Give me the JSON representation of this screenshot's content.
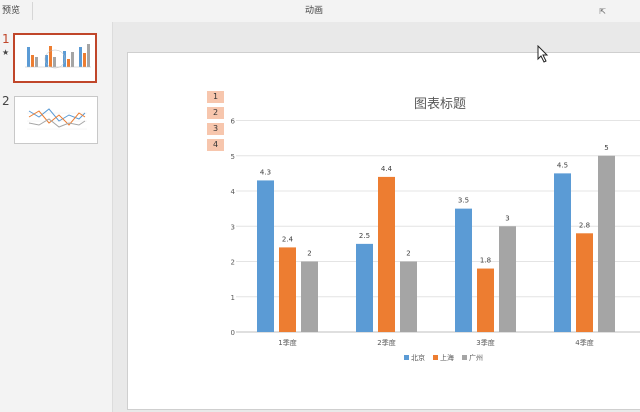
{
  "ribbon": {
    "preview_label": "预览",
    "animation_label": "动画"
  },
  "thumbnails": [
    {
      "number": "1",
      "marker": "★"
    },
    {
      "number": "2"
    }
  ],
  "animation_tags": [
    "1",
    "2",
    "3",
    "4"
  ],
  "colors": {
    "beijing": "#5b9bd5",
    "shanghai": "#ed7d31",
    "guangzhou": "#a5a5a5",
    "accent": "#c0462a"
  },
  "chart_data": {
    "type": "bar",
    "title": "图表标题",
    "categories": [
      "1季度",
      "2季度",
      "3季度",
      "4季度"
    ],
    "series": [
      {
        "name": "北京",
        "values": [
          4.3,
          2.5,
          3.5,
          4.5
        ]
      },
      {
        "name": "上海",
        "values": [
          2.4,
          4.4,
          1.8,
          2.8
        ]
      },
      {
        "name": "广州",
        "values": [
          2,
          2,
          3,
          5
        ]
      }
    ],
    "y_ticks": [
      "0",
      "1",
      "2",
      "3",
      "4",
      "5",
      "6"
    ],
    "ylim": [
      0,
      6
    ],
    "grid": true,
    "legend": "bottom"
  }
}
